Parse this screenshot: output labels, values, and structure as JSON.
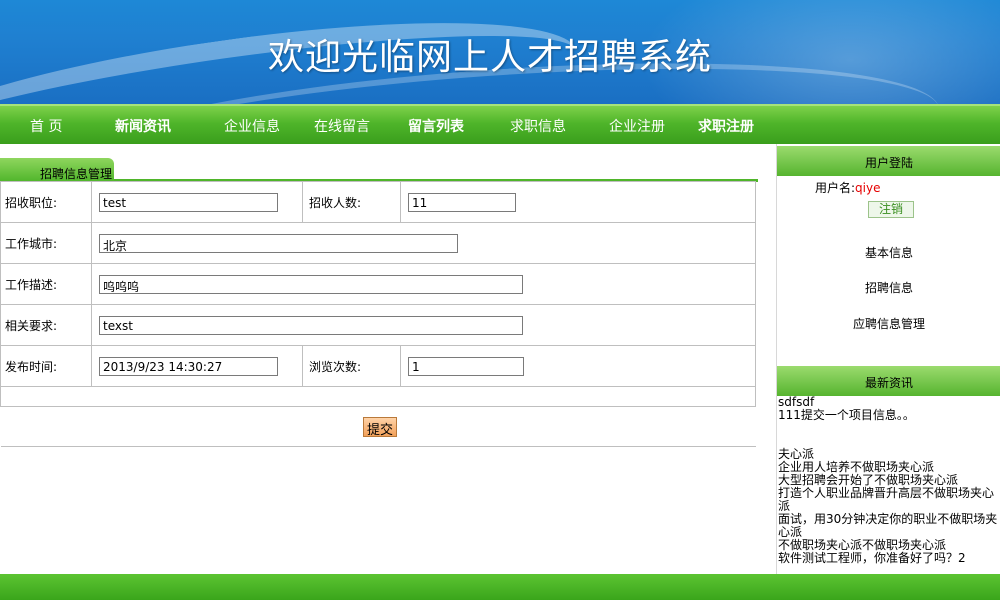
{
  "header": {
    "title": "欢迎光临网上人才招聘系统"
  },
  "nav": {
    "items": [
      {
        "label": "首 页"
      },
      {
        "label": "新闻资讯"
      },
      {
        "label": "企业信息"
      },
      {
        "label": "在线留言"
      },
      {
        "label": "留言列表"
      },
      {
        "label": "求职信息"
      },
      {
        "label": "企业注册"
      },
      {
        "label": "求职注册"
      }
    ]
  },
  "panel": {
    "tab_label": "招聘信息管理"
  },
  "form": {
    "position_label": "招收职位:",
    "position_value": "test",
    "count_label": "招收人数:",
    "count_value": "11",
    "city_label": "工作城市:",
    "city_value": "北京",
    "desc_label": "工作描述:",
    "desc_value": "呜呜呜",
    "req_label": "相关要求:",
    "req_value": "texst",
    "time_label": "发布时间:",
    "time_value": "2013/9/23 14:30:27",
    "views_label": "浏览次数:",
    "views_value": "1",
    "submit_label": "提交"
  },
  "sidebar": {
    "login_title": "用户登陆",
    "username_label": "用户名:",
    "username": "qiye",
    "logout_label": "注销",
    "links": [
      "基本信息",
      "招聘信息",
      "应聘信息管理"
    ],
    "news_title": "最新资讯",
    "news": [
      "sdfsdf",
      "111提交一个项目信息。。",
      "",
      "夫心派",
      "企业用人培养不做职场夹心派",
      "大型招聘会开始了不做职场夹心派",
      "打造个人职业品牌晋升高层不做职场夹心派",
      "面试，用30分钟决定你的职业不做职场夹心派",
      "不做职场夹心派不做职场夹心派",
      "软件测试工程师，你准备好了吗？2"
    ]
  },
  "colors": {
    "banner_blue": "#1f7fd0",
    "nav_green": "#4fb52a",
    "username_red": "#e60000"
  }
}
